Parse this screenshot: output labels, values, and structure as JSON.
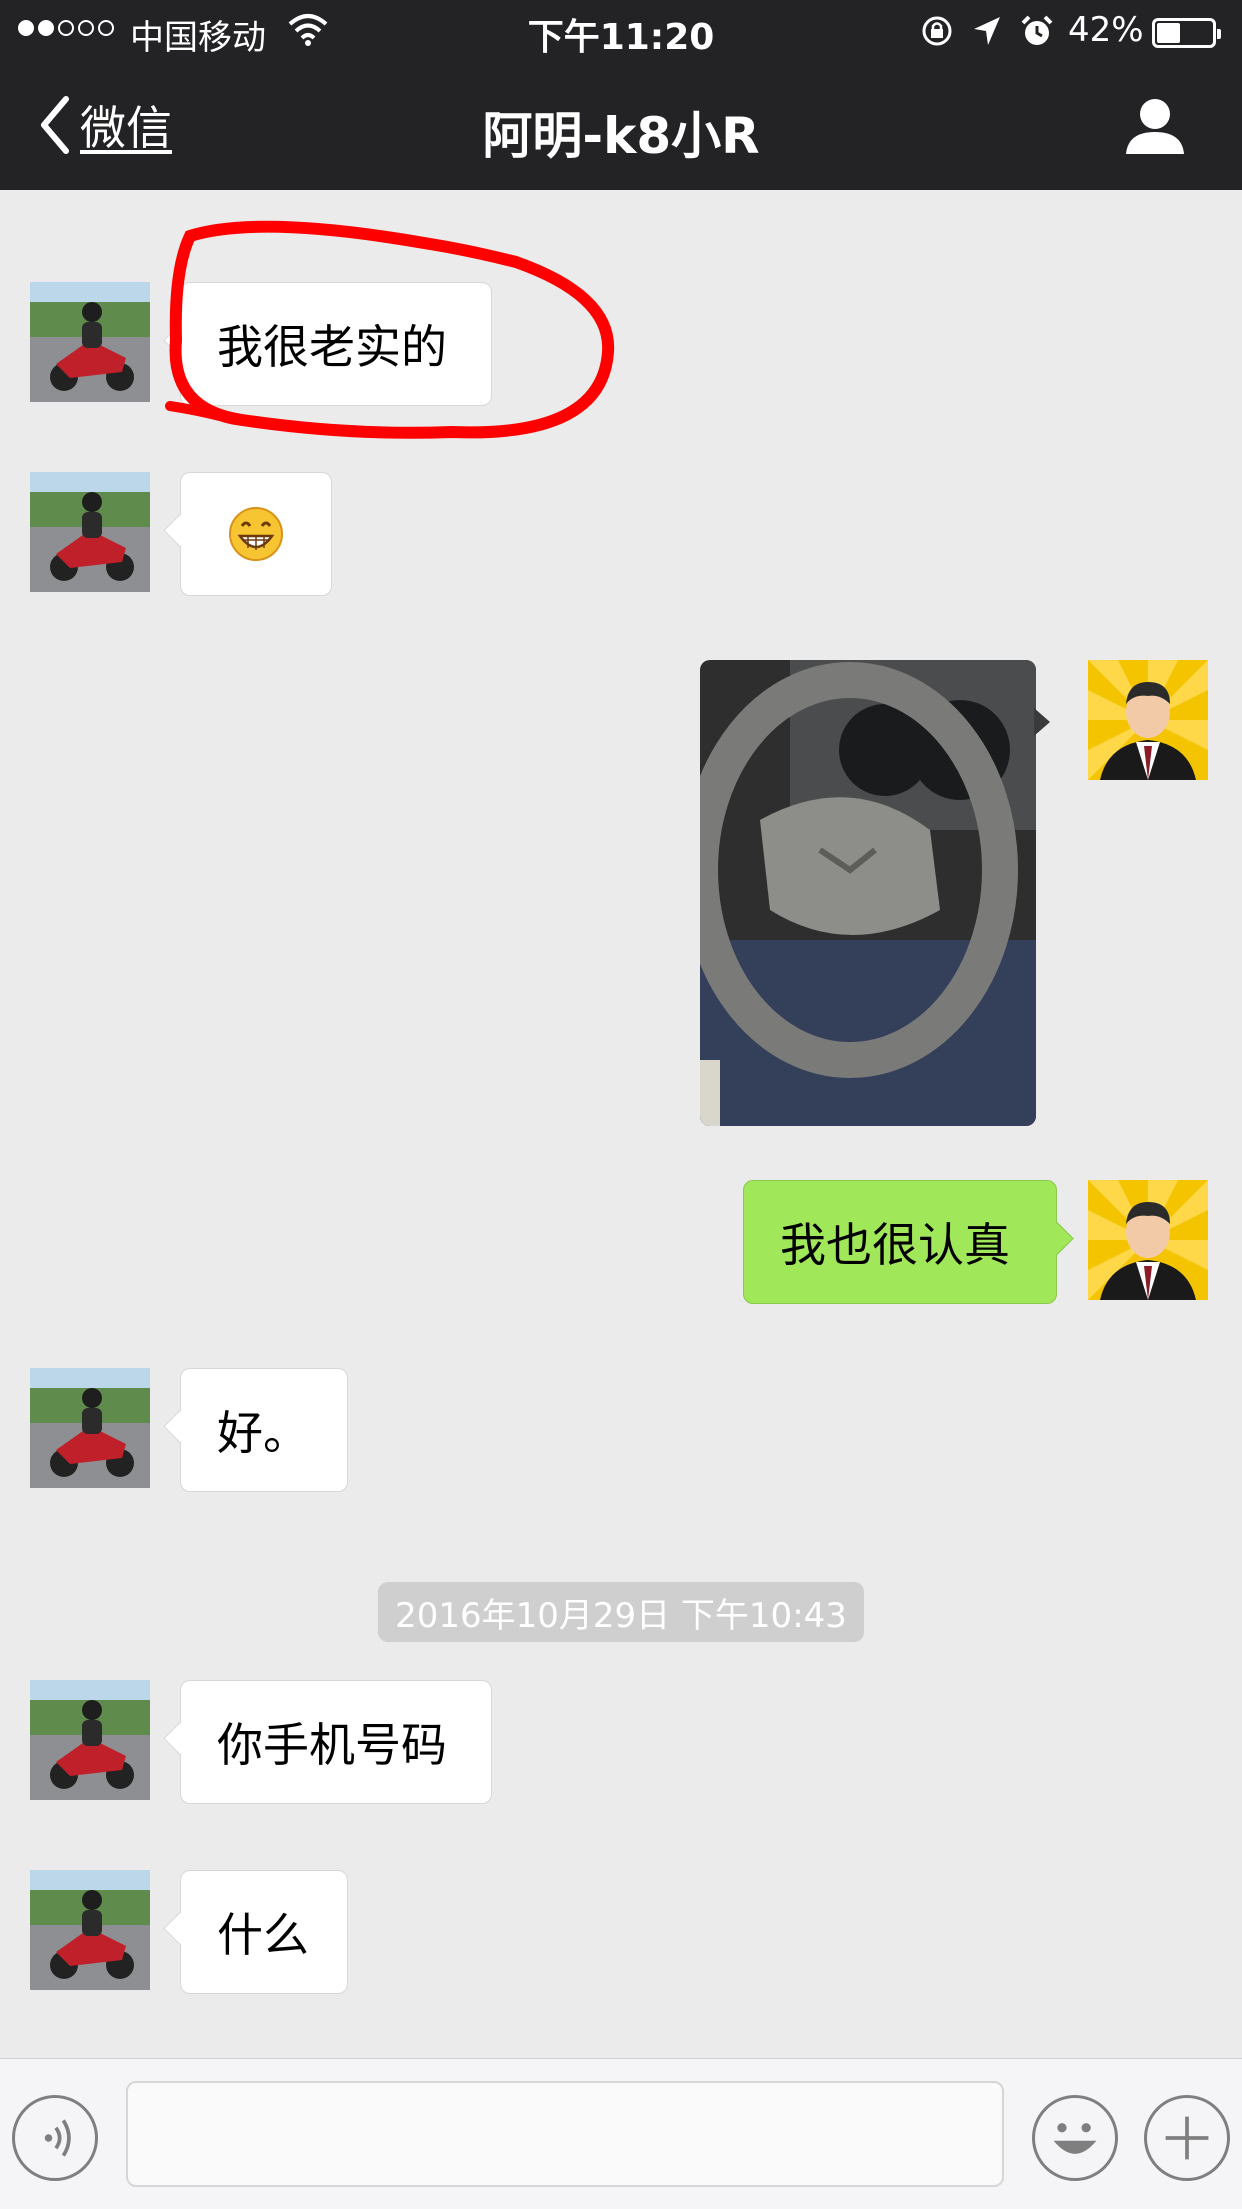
{
  "status_bar": {
    "carrier": "中国移动",
    "time": "下午11:20",
    "battery_percent": "42%",
    "battery_level": 0.42,
    "signal_bars_filled": 2,
    "signal_bars_total": 5,
    "icons": [
      "wifi-icon",
      "rotation-lock-icon",
      "location-arrow-icon",
      "alarm-icon",
      "battery-icon"
    ]
  },
  "nav": {
    "back_label": "微信",
    "title": "阿明-k8小R",
    "right_icon": "person-icon"
  },
  "messages": [
    {
      "side": "left",
      "type": "text",
      "text": "我很老实的",
      "annotated": true
    },
    {
      "side": "left",
      "type": "emoji",
      "emoji": "grinning-face"
    },
    {
      "side": "right",
      "type": "image",
      "image": "steering-wheel-photo"
    },
    {
      "side": "right",
      "type": "text",
      "text": "我也很认真"
    },
    {
      "side": "left",
      "type": "text",
      "text": "好。"
    },
    {
      "type": "timestamp",
      "text": "2016年10月29日 下午10:43"
    },
    {
      "side": "left",
      "type": "text",
      "text": "你手机号码"
    },
    {
      "side": "left",
      "type": "text",
      "text": "什么"
    }
  ],
  "input_bar": {
    "voice_icon": "voice-icon",
    "text_value": "",
    "emoji_icon": "emoji-icon",
    "more_icon": "plus-icon"
  },
  "colors": {
    "nav_bg": "#232326",
    "chat_bg": "#ebebeb",
    "my_bubble": "#a0e75a",
    "their_bubble": "#ffffff",
    "annotation_red": "#ff0000"
  }
}
